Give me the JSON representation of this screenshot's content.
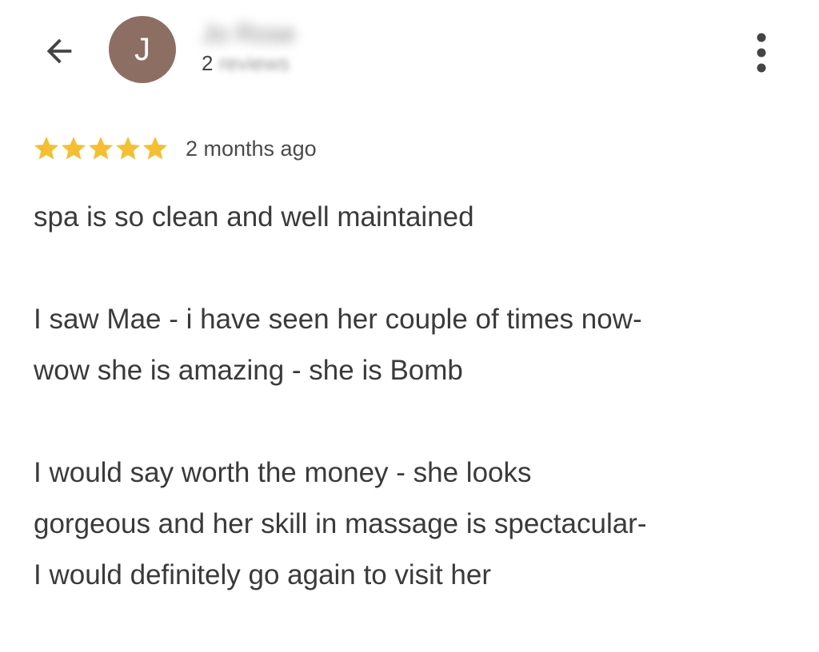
{
  "header": {
    "avatar_initial": "J",
    "reviewer_name": "Jo Rose",
    "review_count_number": "2",
    "review_count_suffix": "reviews"
  },
  "icons": {
    "back": "arrow-left-icon",
    "more": "more-vert-icon",
    "star": "star-icon"
  },
  "colors": {
    "avatar": "#8d6e63",
    "star": "#f5bf2e"
  },
  "rating": {
    "stars": 5,
    "max_stars": 5,
    "time_ago": "2 months ago"
  },
  "review": {
    "paragraphs": [
      {
        "lines": [
          "spa is so clean and well maintained"
        ]
      },
      {
        "lines": [
          "I saw Mae - i have seen her couple of times now-",
          "wow she is amazing - she is Bomb"
        ]
      },
      {
        "lines": [
          "I would say worth the money - she looks",
          "gorgeous and her skill in massage is spectacular-",
          "I would definitely go again to visit her"
        ]
      }
    ]
  }
}
